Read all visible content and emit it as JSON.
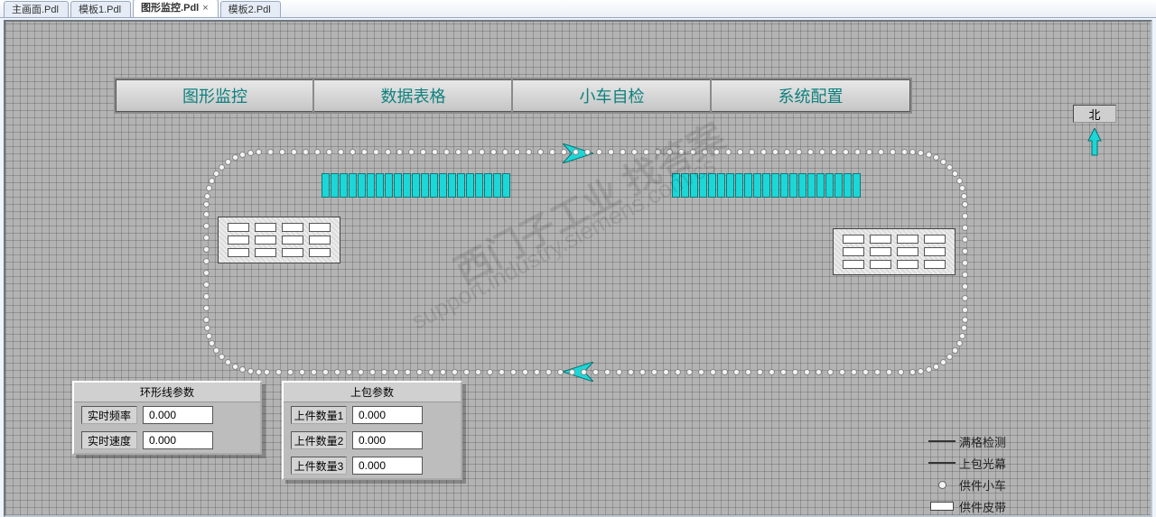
{
  "tabs": [
    {
      "label": "主画面.Pdl",
      "active": false,
      "closable": false
    },
    {
      "label": "模板1.Pdl",
      "active": false,
      "closable": false
    },
    {
      "label": "图形监控.Pdl",
      "active": true,
      "closable": true
    },
    {
      "label": "模板2.Pdl",
      "active": false,
      "closable": false
    }
  ],
  "nav": [
    {
      "label": "图形监控"
    },
    {
      "label": "数据表格"
    },
    {
      "label": "小车自检"
    },
    {
      "label": "系统配置"
    }
  ],
  "compass": {
    "north_label": "北"
  },
  "station_left": {
    "rows": 3,
    "cols": 4
  },
  "station_right": {
    "rows": 3,
    "cols": 4
  },
  "slot_bank_left": {
    "count": 21
  },
  "slot_bank_right": {
    "count": 21
  },
  "param_panel_left": {
    "caption": "环形线参数",
    "rows": [
      {
        "label": "实时频率",
        "value": "0.000"
      },
      {
        "label": "实时速度",
        "value": "0.000"
      }
    ]
  },
  "param_panel_right": {
    "caption": "上包参数",
    "rows": [
      {
        "label": "上件数量1",
        "value": "0.000"
      },
      {
        "label": "上件数量2",
        "value": "0.000"
      },
      {
        "label": "上件数量3",
        "value": "0.000"
      }
    ]
  },
  "legend": [
    {
      "symbol": "line",
      "label": "满格检测"
    },
    {
      "symbol": "line",
      "label": "上包光幕"
    },
    {
      "symbol": "circle",
      "label": "供件小车"
    },
    {
      "symbol": "bar",
      "label": "供件皮带"
    }
  ],
  "watermark": {
    "line1": "西门子工业 找答案",
    "line2": "support.industry.siemens.com/cs"
  }
}
